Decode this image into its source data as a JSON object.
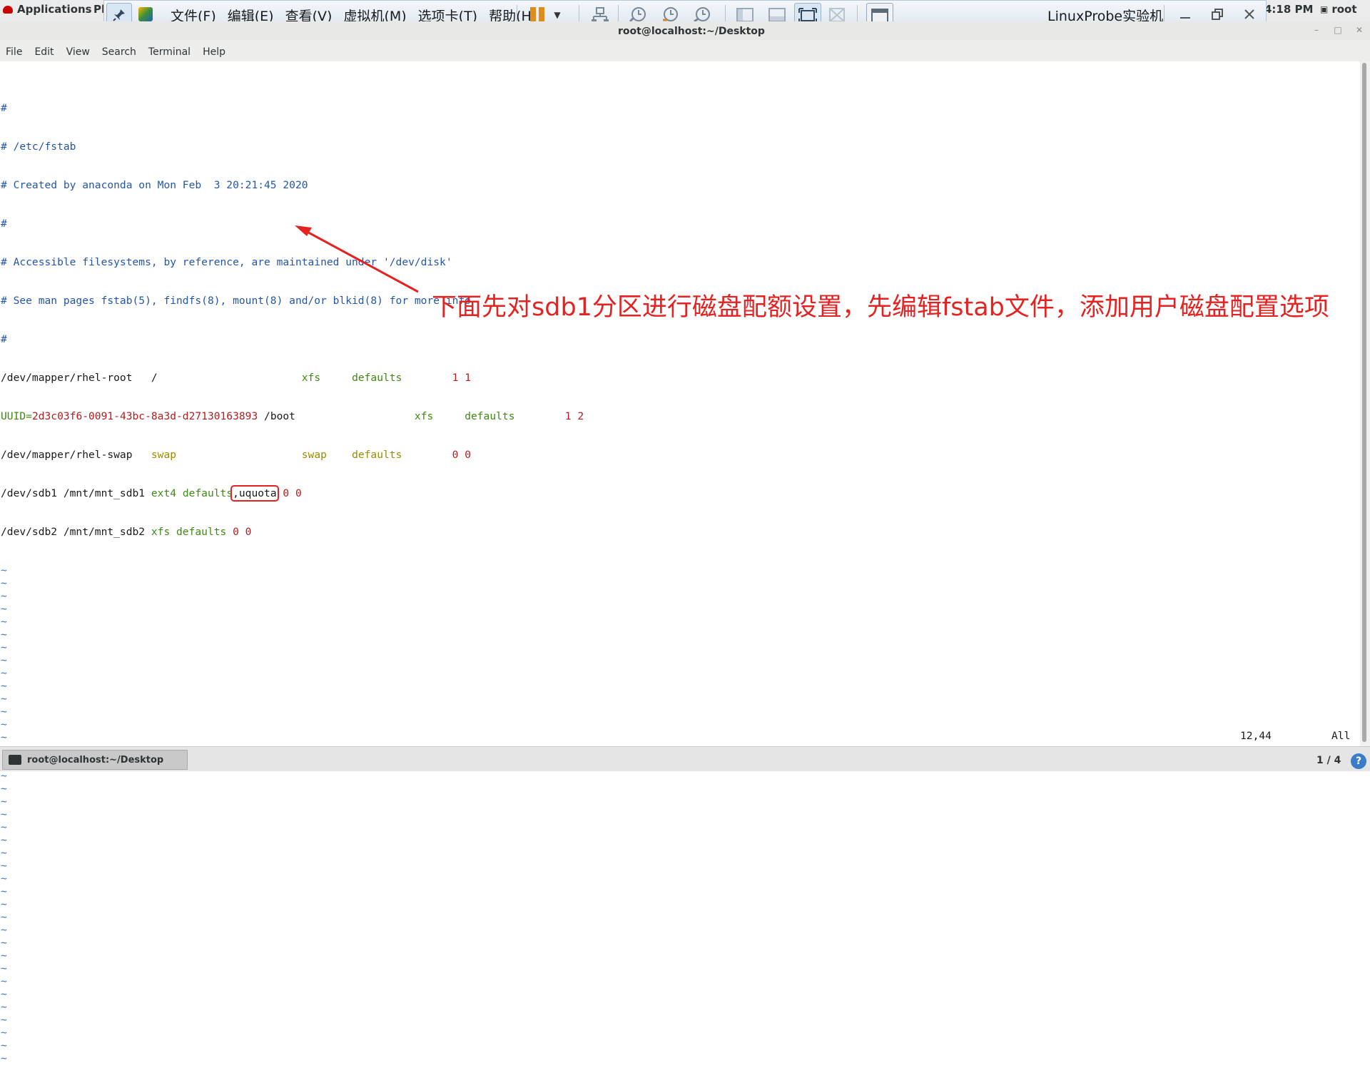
{
  "gnome": {
    "applications": "Applications",
    "places": "Pl",
    "clock": "4:18 PM",
    "user": "root"
  },
  "vmware": {
    "menus": [
      "文件(F)",
      "编辑(E)",
      "查看(V)",
      "虚拟机(M)",
      "选项卡(T)",
      "帮助(H)"
    ],
    "title": "LinuxProbe实验机"
  },
  "terminal": {
    "title": "root@localhost:~/Desktop",
    "menu": [
      "File",
      "Edit",
      "View",
      "Search",
      "Terminal",
      "Help"
    ],
    "lines": {
      "l1": "#",
      "l2": "# /etc/fstab",
      "l3": "# Created by anaconda on Mon Feb  3 20:21:45 2020",
      "l4": "#",
      "l5": "# Accessible filesystems, by reference, are maintained under '/dev/disk'",
      "l6": "# See man pages fstab(5), findfs(8), mount(8) and/or blkid(8) for more info",
      "l7": "#",
      "root_dev": "/dev/mapper/rhel-root",
      "root_mnt": "/",
      "root_fs": "xfs",
      "root_opts": "defaults",
      "root_nums": "1 1",
      "uuid_pre": "UUID=",
      "uuid_val": "2d3c03f6-0091-43bc-8a3d-d27130163893",
      "uuid_mnt": " /boot",
      "boot_fs": "xfs",
      "boot_opts": "defaults",
      "boot_nums": "1 2",
      "swap_dev": "/dev/mapper/rhel-swap",
      "swap_mnt": "swap",
      "swap_fs": "swap",
      "swap_opts": "defaults",
      "swap_nums": "0 0",
      "sdb1_dev": "/dev/sdb1 /mnt/mnt_sdb1 ",
      "sdb1_fs": "ext4",
      "sdb1_opts": " defaults",
      "sdb1_quota": ",uquota",
      "sdb1_nums": " 0 0",
      "sdb2_dev": "/dev/sdb2 /mnt/mnt_sdb2 ",
      "sdb2_fs": "xfs defaults",
      "sdb2_nums": " 0 0",
      "tilde": "~"
    },
    "cursor_pos": "12,44",
    "scroll_pos": "All"
  },
  "annotation": {
    "text": "下面先对sdb1分区进行磁盘配额设置，先编辑fstab文件，添加用户磁盘配置选项",
    "color": "#e52222"
  },
  "taskbar": {
    "task_label": "root@localhost:~/Desktop",
    "workspace": "1 / 4",
    "help": "?"
  }
}
